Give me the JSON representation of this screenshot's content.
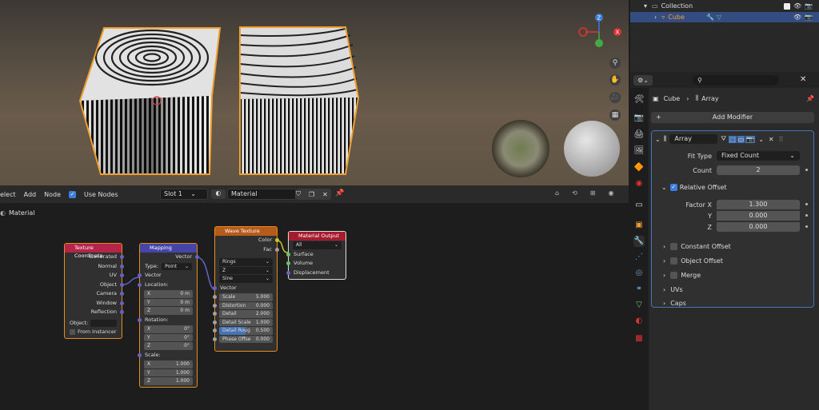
{
  "viewport": {
    "gizmo_x": "X",
    "gizmo_y": "Y",
    "gizmo_z": "Z"
  },
  "node_header": {
    "select": "elect",
    "add": "Add",
    "node": "Node",
    "use_nodes": "Use Nodes",
    "slot": "Slot 1",
    "material": "Material"
  },
  "breadcrumb": "Material",
  "nodes": {
    "texcoord": {
      "title": "Texture Coordinate",
      "outputs": [
        "Generated",
        "Normal",
        "UV",
        "Object",
        "Camera",
        "Window",
        "Reflection"
      ],
      "object_label": "Object:",
      "from_instancer": "From Instancer"
    },
    "mapping": {
      "title": "Mapping",
      "vector_out": "Vector",
      "type_label": "Type:",
      "type_value": "Point",
      "vector_in": "Vector",
      "location": "Location:",
      "loc": [
        {
          "axis": "X",
          "val": "0 m"
        },
        {
          "axis": "Y",
          "val": "0 m"
        },
        {
          "axis": "Z",
          "val": "0 m"
        }
      ],
      "rotation": "Rotation:",
      "rot": [
        {
          "axis": "X",
          "val": "0°"
        },
        {
          "axis": "Y",
          "val": "0°"
        },
        {
          "axis": "Z",
          "val": "0°"
        }
      ],
      "scale": "Scale:",
      "scl": [
        {
          "axis": "X",
          "val": "1.000"
        },
        {
          "axis": "Y",
          "val": "1.000"
        },
        {
          "axis": "Z",
          "val": "1.000"
        }
      ]
    },
    "wave": {
      "title": "Wave Texture",
      "color": "Color",
      "fac": "Fac",
      "dd1": "Rings",
      "dd2": "Z",
      "dd3": "Sine",
      "vector": "Vector",
      "params": [
        {
          "label": "Scale",
          "val": "5.000"
        },
        {
          "label": "Distortion",
          "val": "0.000"
        },
        {
          "label": "Detail",
          "val": "2.000"
        },
        {
          "label": "Detail Scale",
          "val": "1.000"
        },
        {
          "label": "Detail Roug",
          "val": "0.500"
        },
        {
          "label": "Phase Offse",
          "val": "0.000"
        }
      ]
    },
    "output": {
      "title": "Material Output",
      "target": "All",
      "surface": "Surface",
      "volume": "Volume",
      "displacement": "Displacement"
    }
  },
  "outliner": {
    "collection": "Collection",
    "cube": "Cube"
  },
  "properties": {
    "breadcrumb_obj": "Cube",
    "breadcrumb_mod": "Array",
    "add_modifier": "Add Modifier",
    "modifier_name": "Array",
    "fit_type_label": "Fit Type",
    "fit_type_value": "Fixed Count",
    "count_label": "Count",
    "count_value": "2",
    "relative_offset": "Relative Offset",
    "factor_x_label": "Factor X",
    "factor_x": "1.300",
    "y_label": "Y",
    "factor_y": "0.000",
    "z_label": "Z",
    "factor_z": "0.000",
    "constant_offset": "Constant Offset",
    "object_offset": "Object Offset",
    "merge": "Merge",
    "uvs": "UVs",
    "caps": "Caps"
  },
  "colors": {
    "accent": "#3d7fe0",
    "selection": "#e98a1d",
    "texcoord_header": "#b5254a",
    "mapping_header": "#4545a8",
    "wave_header": "#b55c1c",
    "output_header": "#a51c2e"
  }
}
